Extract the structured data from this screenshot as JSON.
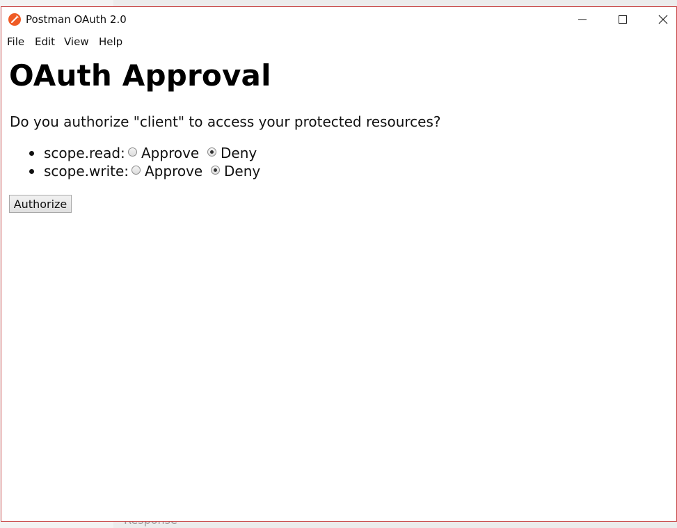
{
  "window": {
    "title": "Postman OAuth 2.0"
  },
  "menu": [
    "File",
    "Edit",
    "View",
    "Help"
  ],
  "page": {
    "heading": "OAuth Approval",
    "question": "Do you authorize \"client\" to access your protected resources?"
  },
  "scopes": [
    {
      "label": "scope.read:",
      "approve_label": "Approve",
      "deny_label": "Deny",
      "selected": "Deny"
    },
    {
      "label": "scope.write:",
      "approve_label": "Approve",
      "deny_label": "Deny",
      "selected": "Deny"
    }
  ],
  "actions": {
    "authorize_label": "Authorize"
  },
  "background": {
    "text": "Response"
  },
  "colors": {
    "frame_border": "#c94a4a",
    "app_icon": "#ef5b25"
  }
}
